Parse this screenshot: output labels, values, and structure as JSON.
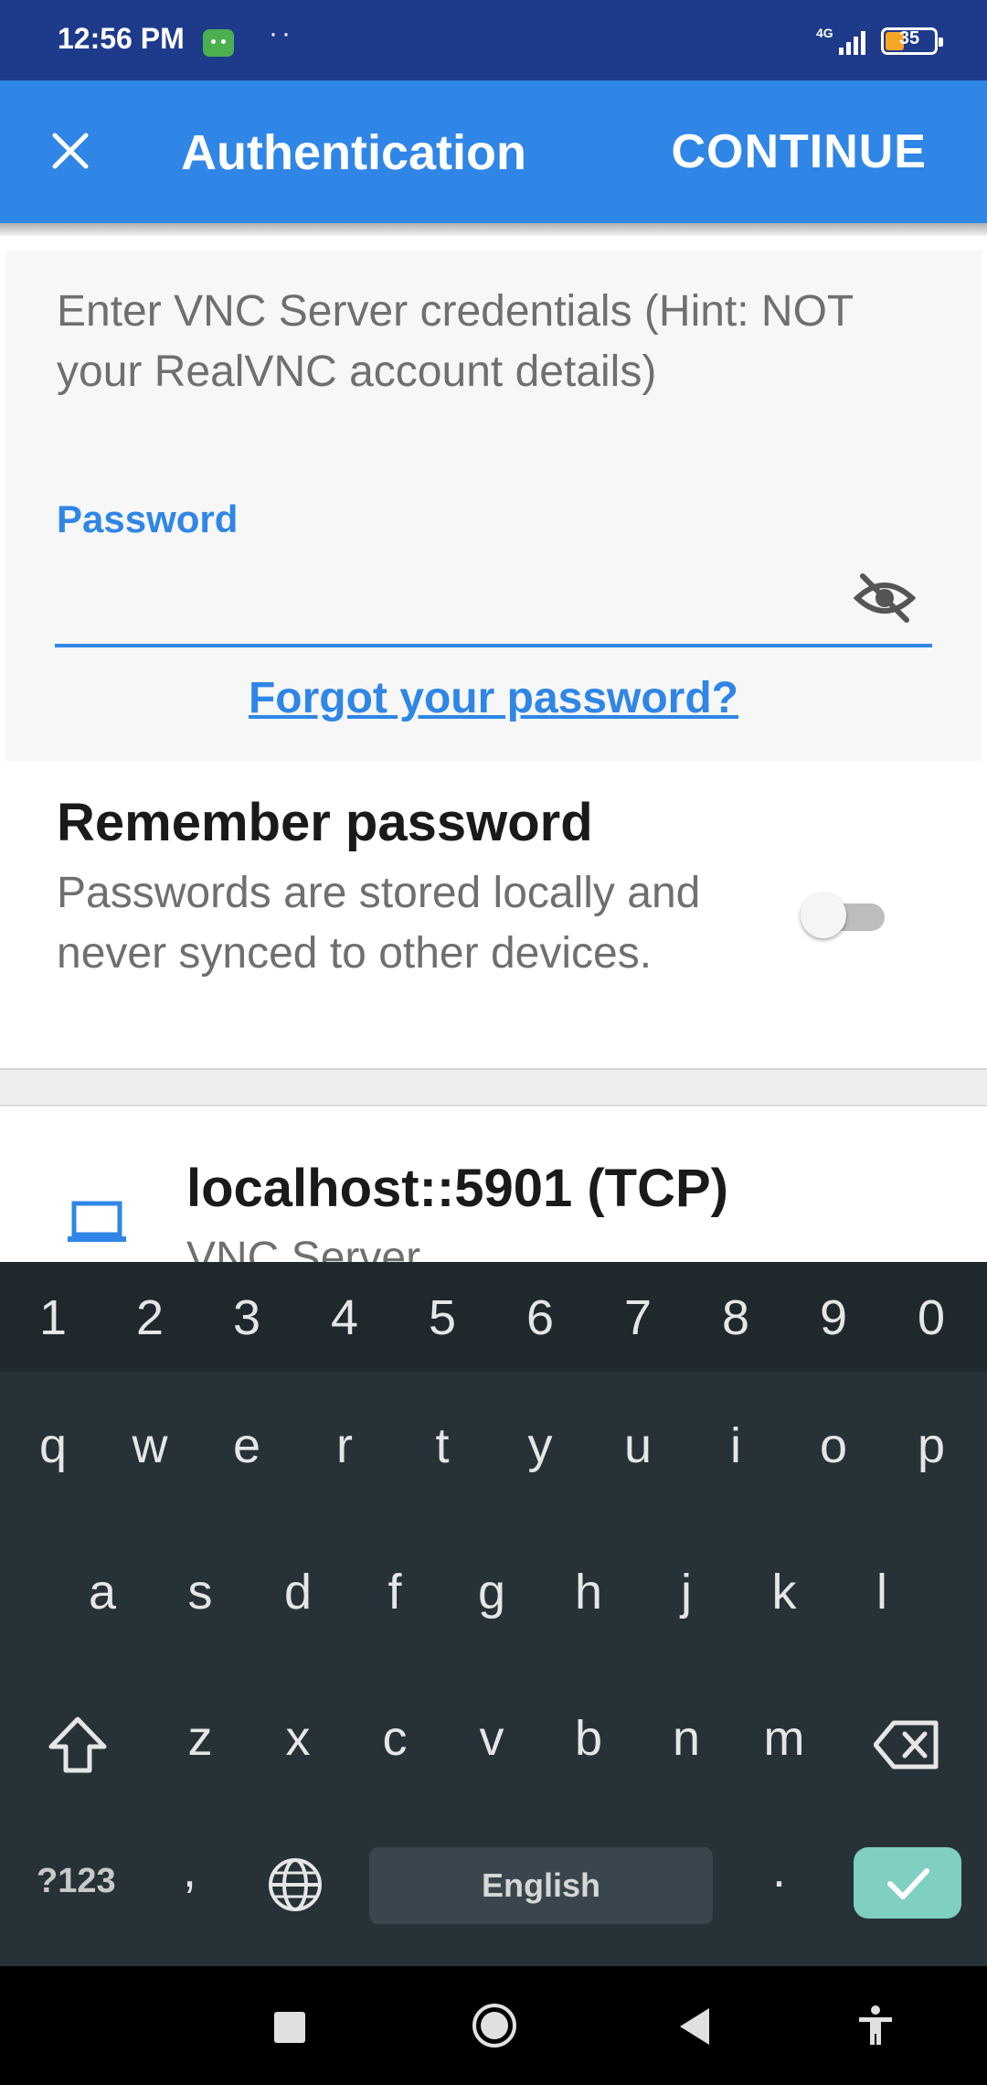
{
  "status_bar": {
    "time": "12:56 PM",
    "dots": "··",
    "network": "4G",
    "battery_level": "35"
  },
  "app_bar": {
    "close_icon": "close-icon",
    "title": "Authentication",
    "continue_label": "CONTINUE"
  },
  "credentials": {
    "hint": "Enter VNC Server credentials (Hint: NOT your RealVNC account details)",
    "password_label": "Password",
    "password_value": "",
    "visibility_icon": "eye-off-icon",
    "forgot_link": "Forgot your password?"
  },
  "remember": {
    "title": "Remember password",
    "description": "Passwords are stored locally and never synced to other devices.",
    "enabled": false
  },
  "server": {
    "icon": "laptop-icon",
    "name": "localhost::5901 (TCP)",
    "subtitle": "VNC Server"
  },
  "keyboard": {
    "numbers": [
      "1",
      "2",
      "3",
      "4",
      "5",
      "6",
      "7",
      "8",
      "9",
      "0"
    ],
    "row1": [
      "q",
      "w",
      "e",
      "r",
      "t",
      "y",
      "u",
      "i",
      "o",
      "p"
    ],
    "row2": [
      "a",
      "s",
      "d",
      "f",
      "g",
      "h",
      "j",
      "k",
      "l"
    ],
    "row3": [
      "z",
      "x",
      "c",
      "v",
      "b",
      "n",
      "m"
    ],
    "symbols_key": "?123",
    "comma": ",",
    "space_label": "English",
    "period": ".",
    "accent_color": "#7fcfc2"
  },
  "colors": {
    "status_bar": "#1e3a8a",
    "app_bar": "#2f86e6",
    "keyboard_bg": "#263238"
  }
}
